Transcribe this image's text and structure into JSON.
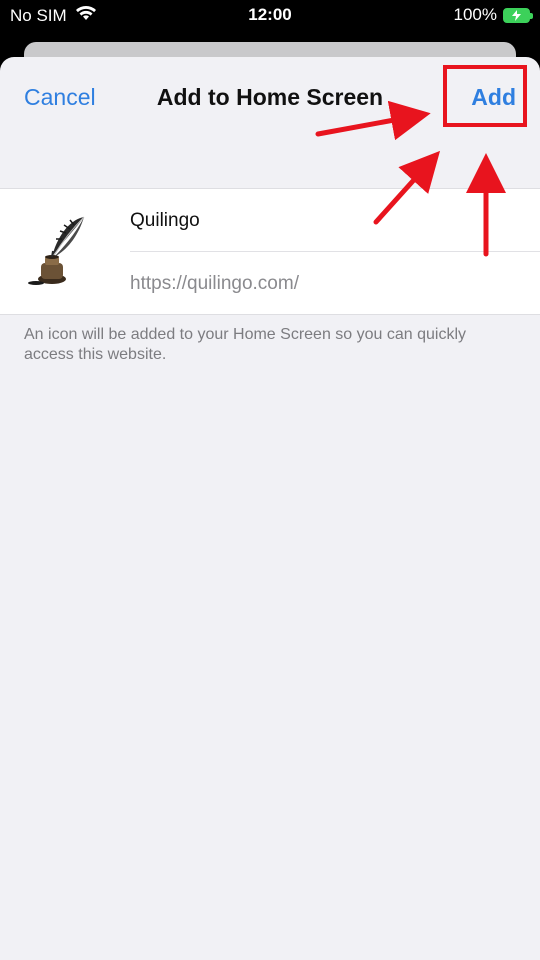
{
  "status_bar": {
    "carrier": "No SIM",
    "time": "12:00",
    "battery_percent": "100%",
    "wifi_icon": "wifi-icon",
    "battery_icon": "battery-charging-icon",
    "battery_color": "#3cd15a"
  },
  "nav": {
    "cancel_label": "Cancel",
    "title": "Add to Home Screen",
    "add_label": "Add",
    "accent_color": "#2f7fe0"
  },
  "form": {
    "name_value": "Quilingo",
    "url": "https://quilingo.com/",
    "icon": "quill-inkwell-icon"
  },
  "footnote": "An icon will be added to your Home Screen so you can quickly access this website.",
  "annotations": {
    "highlight_color": "#e8141e",
    "arrow_count": 3
  }
}
